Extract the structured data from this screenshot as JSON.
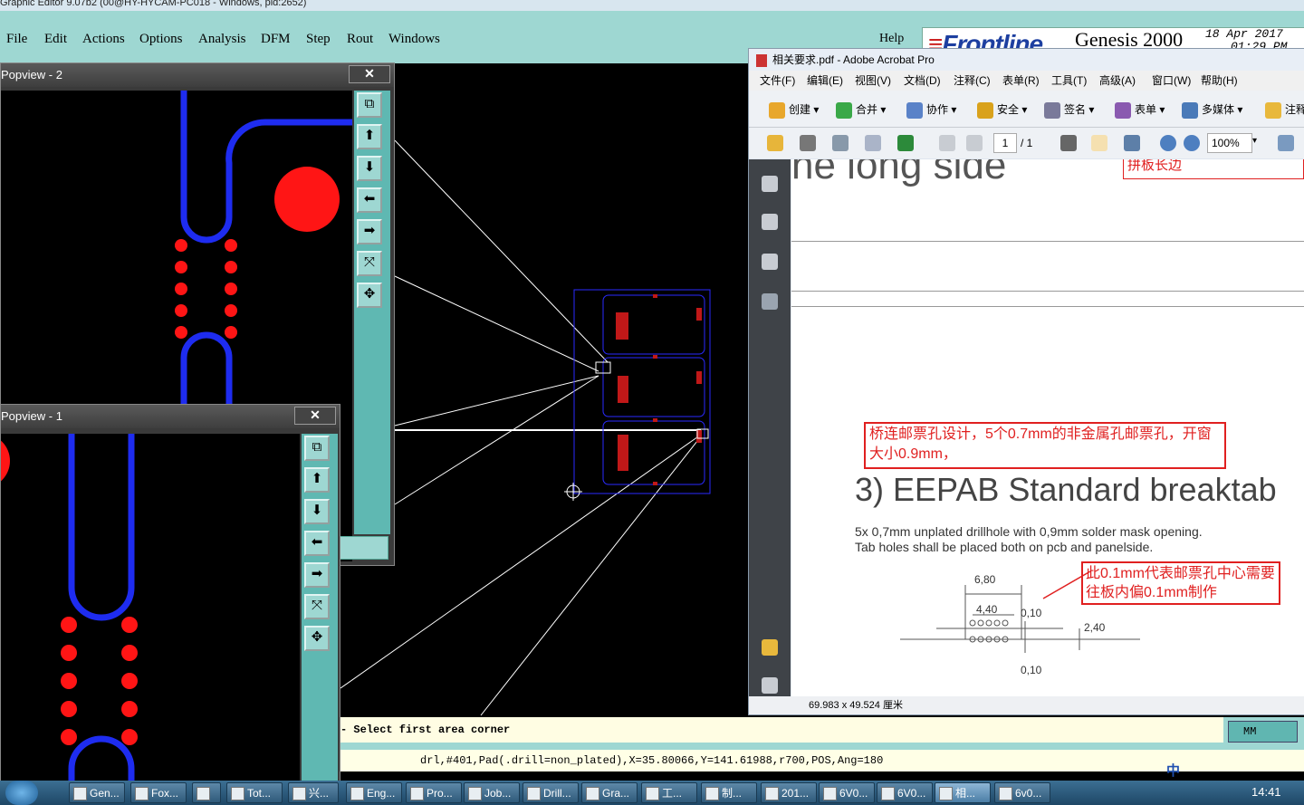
{
  "genesis": {
    "title_bar": "Graphic Editor 9.07b2 (00@HY-HYCAM-PC018 - Windows, pid:2652)",
    "menu": [
      "File",
      "Edit",
      "Actions",
      "Options",
      "Analysis",
      "DFM",
      "Step",
      "Rout",
      "Windows"
    ],
    "help": "Help",
    "brand_logo_prefix": "≡",
    "brand_logo": "Frontline",
    "brand_name": "Genesis 2000",
    "brand_date": "18 Apr 2017",
    "brand_time": "01:29 PM",
    "prompt": "- Select first area corner",
    "units": "MM",
    "status": "drl,#401,Pad(.drill=non_plated),X=35.80066,Y=141.61988,r700,POS,Ang=180"
  },
  "popview2": {
    "title": "Popview - 2",
    "close": "✕"
  },
  "popview1": {
    "title": "Popview - 1",
    "close": "✕"
  },
  "acrobat": {
    "title": "相关要求.pdf - Adobe Acrobat Pro",
    "menu": [
      "文件(F)",
      "编辑(E)",
      "视图(V)",
      "文档(D)",
      "注释(C)",
      "表单(R)",
      "工具(T)",
      "高级(A)",
      "窗口(W)",
      "帮助(H)"
    ],
    "toolbar": [
      "创建 ▾",
      "合并 ▾",
      "协作 ▾",
      "安全 ▾",
      "签名 ▾",
      "表单 ▾",
      "多媒体 ▾",
      "注释"
    ],
    "page_num": "1",
    "page_total": "/ 1",
    "zoom": "100%",
    "status_size": "69.983 x 49.524 厘米",
    "doc": {
      "heading_top": "he long side",
      "annot_top": "拼板长边",
      "annot_1": "桥连邮票孔设计，5个0.7mm的非金属孔邮票孔，开窗大小0.9mm，",
      "heading": "3)  EEPAB Standard breaktab",
      "desc_1": "5x 0,7mm unplated drillhole with 0,9mm solder mask opening.",
      "desc_2": "Tab holes shall be placed both on pcb and panelside.",
      "annot_2": "此0.1mm代表邮票孔中心需要往板内偏0.1mm制作",
      "dim_680": "6,80",
      "dim_440": "4,40",
      "dim_010a": "0,10",
      "dim_240": "2,40",
      "dim_010b": "0,10"
    }
  },
  "taskbar": {
    "items": [
      "Gen...",
      "Fox...",
      "",
      "Tot...",
      "兴...",
      "Eng...",
      "Pro...",
      "Job...",
      "Drill...",
      "Gra...",
      "工...",
      "制...",
      "201...",
      "6V0...",
      "6V0...",
      "相...",
      "6v0..."
    ],
    "ime": "中",
    "clock": "14:41"
  }
}
